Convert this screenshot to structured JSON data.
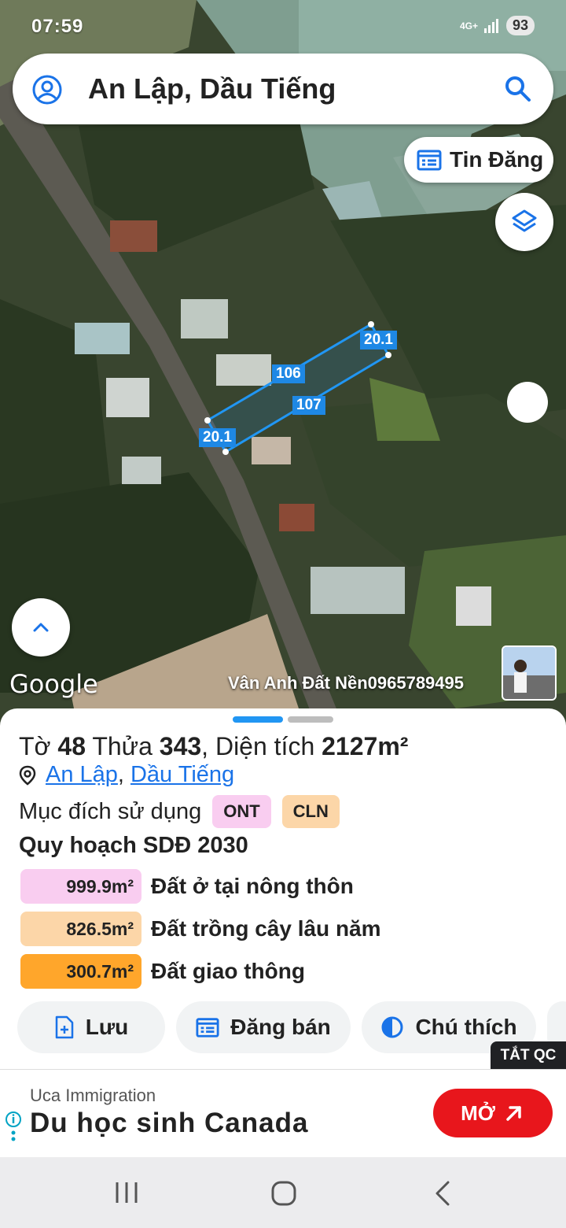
{
  "status_bar": {
    "time": "07:59",
    "network": "4G+",
    "battery": "93"
  },
  "search": {
    "query": "An Lập, Dầu Tiếng"
  },
  "map": {
    "tin_dang_label": "Tin Đăng",
    "google_label": "Google",
    "watermark": "Vân Anh Đất Nền0965789495",
    "plot_edges": [
      "20.1",
      "106",
      "107",
      "20.1"
    ]
  },
  "parcel": {
    "to_label": "Tờ",
    "to_value": "48",
    "thua_label": "Thửa",
    "thua_value": "343",
    "dien_tich_label": ", Diện tích",
    "dien_tich_value": "2127m²",
    "location_commune": "An Lập",
    "location_separator": ",",
    "location_district": "Dầu Tiếng",
    "purpose_label": "Mục đích sử dụng",
    "purpose_tags": [
      {
        "code": "ONT",
        "color": "#f9cdf0"
      },
      {
        "code": "CLN",
        "color": "#fcd6a8"
      }
    ],
    "plan_title": "Quy hoạch SDĐ 2030",
    "plan_rows": [
      {
        "area": "999.9m²",
        "label": "Đất ở tại nông thôn",
        "color": "#f9cdf0"
      },
      {
        "area": "826.5m²",
        "label": "Đất trồng cây lâu năm",
        "color": "#fcd6a8"
      },
      {
        "area": "300.7m²",
        "label": "Đất giao thông",
        "color": "#ffa62b"
      }
    ]
  },
  "actions": {
    "save": "Lưu",
    "post_sale": "Đăng bán",
    "legend": "Chú thích"
  },
  "ad": {
    "close_label": "TẮT QC",
    "brand": "Uca Immigration",
    "title": "Du học sinh Canada",
    "button": "MỞ"
  }
}
